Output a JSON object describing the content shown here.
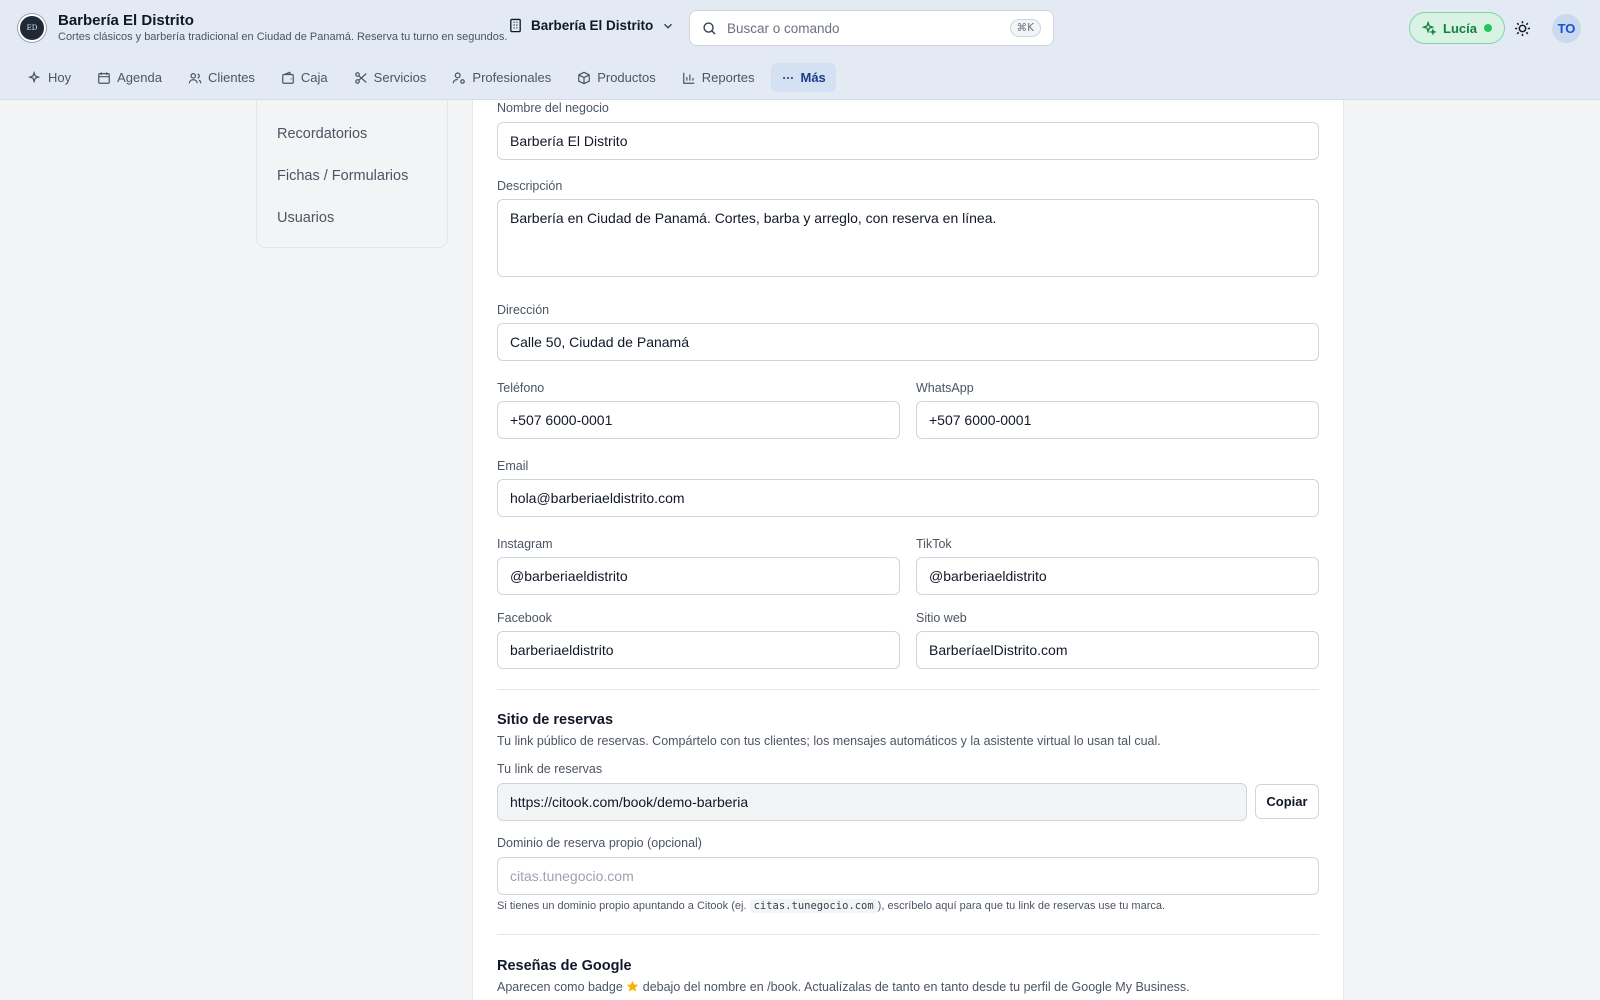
{
  "header": {
    "brand_name": "Barbería El Distrito",
    "brand_tagline": "Cortes clásicos y barbería tradicional en Ciudad de Panamá. Reserva tu turno en segundos.",
    "business_switcher": "Barbería El Distrito",
    "search_placeholder": "Buscar o comando",
    "search_shortcut": "⌘K",
    "assistant_label": "Lucía",
    "avatar_initials": "TO"
  },
  "nav": [
    "Hoy",
    "Agenda",
    "Clientes",
    "Caja",
    "Servicios",
    "Profesionales",
    "Productos",
    "Reportes",
    "Más"
  ],
  "sidebar": [
    "Recordatorios",
    "Fichas / Formularios",
    "Usuarios"
  ],
  "form": {
    "business_name": {
      "label": "Nombre del negocio",
      "value": "Barbería El Distrito"
    },
    "description": {
      "label": "Descripción",
      "value": "Barbería en Ciudad de Panamá. Cortes, barba y arreglo, con reserva en línea."
    },
    "address": {
      "label": "Dirección",
      "value": "Calle 50, Ciudad de Panamá"
    },
    "phone": {
      "label": "Teléfono",
      "value": "+507 6000-0001"
    },
    "whatsapp": {
      "label": "WhatsApp",
      "value": "+507 6000-0001"
    },
    "email": {
      "label": "Email",
      "value": "hola@barberiaeldistrito.com"
    },
    "instagram": {
      "label": "Instagram",
      "value": "@barberiaeldistrito"
    },
    "tiktok": {
      "label": "TikTok",
      "value": "@barberiaeldistrito"
    },
    "facebook": {
      "label": "Facebook",
      "value": "barberiaeldistrito"
    },
    "website": {
      "label": "Sitio web",
      "value": "BarberíaelDistrito.com"
    }
  },
  "booking": {
    "title": "Sitio de reservas",
    "help": "Tu link público de reservas. Compártelo con tus clientes; los mensajes automáticos y la asistente virtual lo usan tal cual.",
    "link_label": "Tu link de reservas",
    "link_value": "https://citook.com/book/demo-barberia",
    "copy_label": "Copiar",
    "domain_label": "Dominio de reserva propio (opcional)",
    "domain_placeholder": "citas.tunegocio.com",
    "note_before": "Si tienes un dominio propio apuntando a Citook (ej.",
    "note_code": "citas.tunegocio.com",
    "note_after": "), escríbelo aquí para que tu link de reservas use tu marca."
  },
  "reviews": {
    "title": "Reseñas de Google",
    "help_before": "Aparecen como badge",
    "help_after": "debajo del nombre en /book. Actualízalas de tanto en tanto desde tu perfil de Google My Business."
  },
  "colors": {
    "accent": "#1e3a8a",
    "assistant": "#15803d",
    "header_bg": "#e3eaf4"
  }
}
